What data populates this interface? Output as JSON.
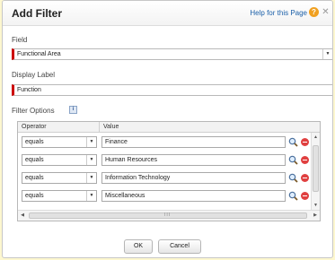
{
  "dialog": {
    "title": "Add Filter",
    "help_link": "Help for this Page",
    "help_icon": "?"
  },
  "field": {
    "label": "Field",
    "value": "Functional Area"
  },
  "display_label": {
    "label": "Display Label",
    "value": "Function"
  },
  "filter_options": {
    "label": "Filter Options",
    "info_icon": "i",
    "columns": [
      "Operator",
      "Value"
    ],
    "rows": [
      {
        "operator": "equals",
        "value": "Finance"
      },
      {
        "operator": "equals",
        "value": "Human Resources"
      },
      {
        "operator": "equals",
        "value": "Information Technology"
      },
      {
        "operator": "equals",
        "value": "Miscellaneous"
      }
    ],
    "scroll_grip": "III"
  },
  "buttons": {
    "ok": "OK",
    "cancel": "Cancel"
  },
  "colors": {
    "required_marker": "#cc0000",
    "help_link": "#1a5fa8",
    "remove": "#e04040"
  }
}
